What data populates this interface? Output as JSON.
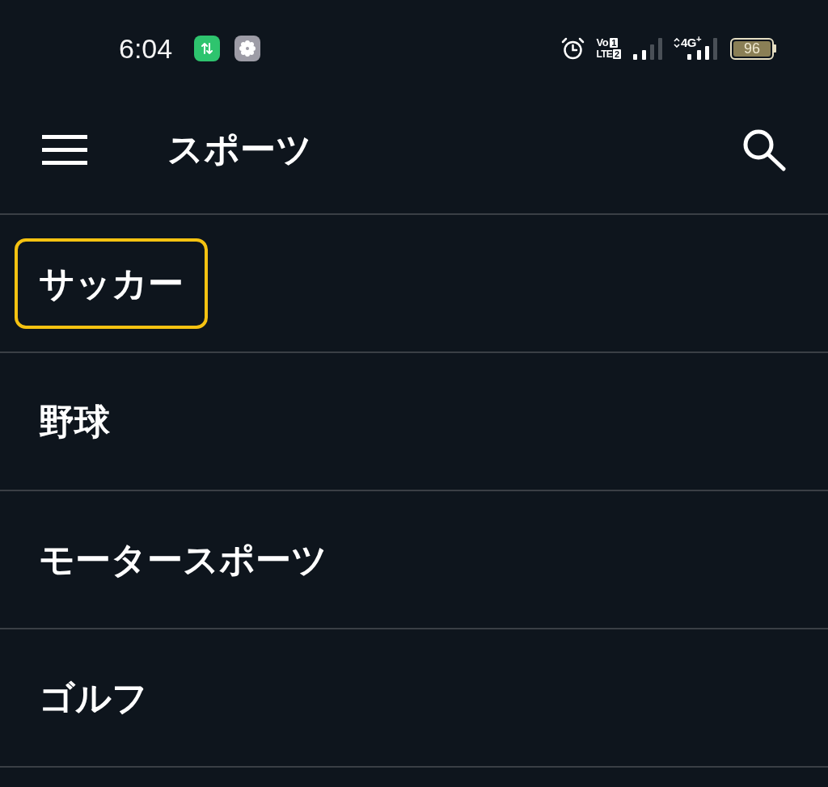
{
  "status_bar": {
    "time": "6:04",
    "volte": {
      "line_1": "Vo",
      "line_2": "LTE",
      "sim_1": "1",
      "sim_2": "2"
    },
    "network": "4G$^{+}$",
    "battery": "96"
  },
  "app_bar": {
    "title": "スポーツ"
  },
  "list": {
    "items": [
      {
        "label": "サッカー",
        "focused": true
      },
      {
        "label": "野球",
        "focused": false
      },
      {
        "label": "モータースポーツ",
        "focused": false
      },
      {
        "label": "ゴルフ",
        "focused": false
      }
    ]
  }
}
